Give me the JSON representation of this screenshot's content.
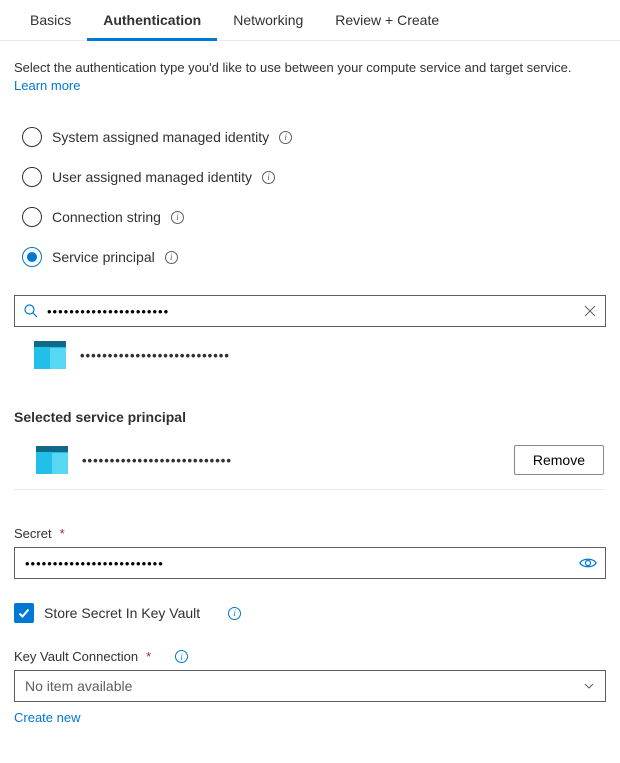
{
  "tabs": {
    "basics": "Basics",
    "authentication": "Authentication",
    "networking": "Networking",
    "review": "Review + Create"
  },
  "intro": {
    "text_before": "Select the authentication type you'd like to use between your compute service and target service. ",
    "link": "Learn more"
  },
  "radios": {
    "system": "System assigned managed identity",
    "user": "User assigned managed identity",
    "connstr": "Connection string",
    "sp": "Service principal"
  },
  "search": {
    "value": "••••••••••••••••••••••"
  },
  "result": {
    "name": "•••••••••••••••••••••••••••"
  },
  "selected_header": "Selected service principal",
  "selected": {
    "name": "•••••••••••••••••••••••••••",
    "remove": "Remove"
  },
  "secret": {
    "label": "Secret",
    "value": "•••••••••••••••••••••••••"
  },
  "store_kv": {
    "label": "Store Secret In Key Vault"
  },
  "kv_conn": {
    "label": "Key Vault Connection",
    "placeholder": "No item available"
  },
  "create_new": "Create new"
}
